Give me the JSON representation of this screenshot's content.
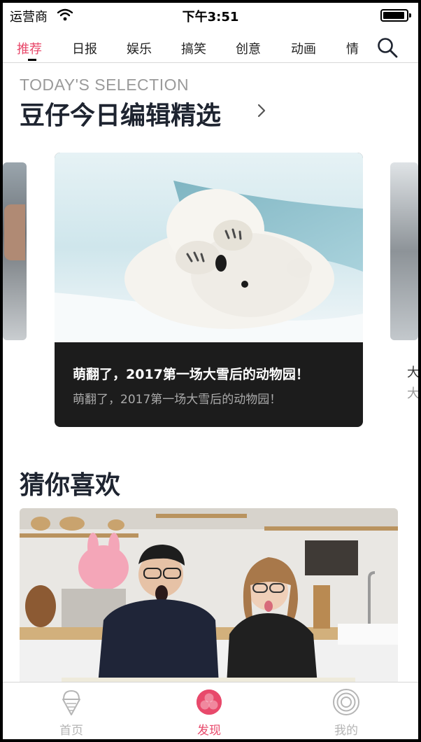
{
  "status_bar": {
    "carrier": "运营商",
    "time": "下午3:51",
    "battery_level": 0.8
  },
  "category_tabs": {
    "items": [
      "推荐",
      "日报",
      "娱乐",
      "搞笑",
      "创意",
      "动画",
      "情"
    ],
    "active_index": 0
  },
  "selection": {
    "subtitle_en": "TODAY'S SELECTION",
    "title": "豆仔今日编辑精选"
  },
  "carousel": {
    "main_caption": "萌翻了，2017第一场大雪后的动物园！",
    "main_subcaption": "萌翻了，2017第一场大雪后的动物园！",
    "peek_right_title": "大",
    "peek_right_sub": "大"
  },
  "recommend": {
    "title": "猜你喜欢"
  },
  "bottom_tabs": {
    "items": [
      {
        "label": "首页",
        "icon": "ice-cream-icon"
      },
      {
        "label": "发现",
        "icon": "clover-icon"
      },
      {
        "label": "我的",
        "icon": "concentric-circles-icon"
      }
    ],
    "active_index": 1
  },
  "colors": {
    "accent": "#e8496b",
    "title": "#1e2430",
    "muted": "#9a9a9a",
    "card_bg": "#1c1c1c"
  }
}
